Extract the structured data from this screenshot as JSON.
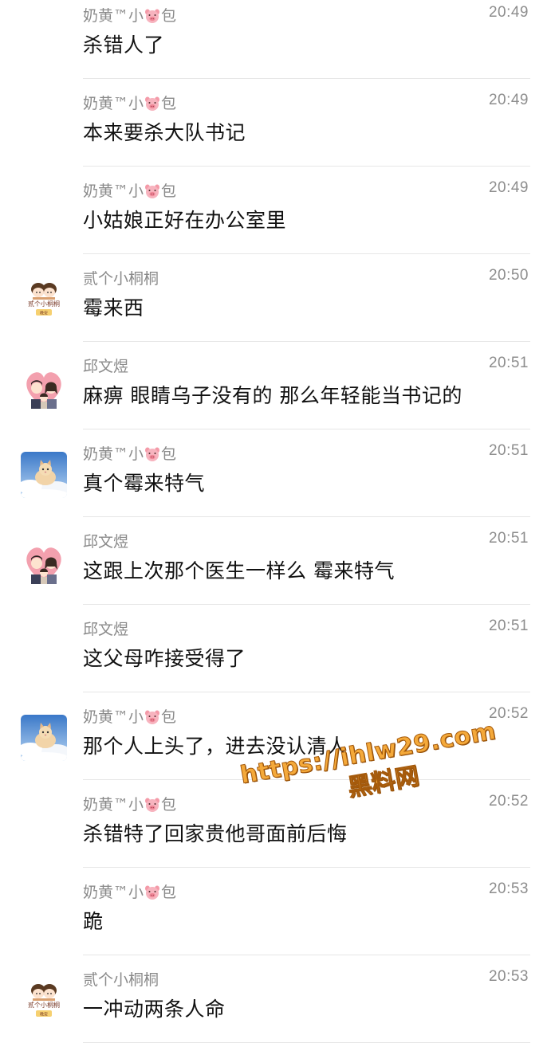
{
  "messages": [
    {
      "sender_pre": "奶黄™小",
      "sender_post": "包",
      "pig": true,
      "time": "20:49",
      "text": "杀错人了",
      "avatar": "none"
    },
    {
      "sender_pre": "奶黄™小",
      "sender_post": "包",
      "pig": true,
      "time": "20:49",
      "text": "本来要杀大队书记",
      "avatar": "none"
    },
    {
      "sender_pre": "奶黄™小",
      "sender_post": "包",
      "pig": true,
      "time": "20:49",
      "text": "小姑娘正好在办公室里",
      "avatar": "none"
    },
    {
      "sender_pre": "贰个小桐桐",
      "sender_post": "",
      "pig": false,
      "time": "20:50",
      "text": "霉来西",
      "avatar": "tongtong",
      "avatar_line1": "贰个小桐桐",
      "avatar_line2": "晚安"
    },
    {
      "sender_pre": "邱文煜",
      "sender_post": "",
      "pig": false,
      "time": "20:51",
      "text": "麻痹 眼睛乌子没有的 那么年轻能当书记的",
      "avatar": "family"
    },
    {
      "sender_pre": "奶黄™小",
      "sender_post": "包",
      "pig": true,
      "time": "20:51",
      "text": "真个霉来特气",
      "avatar": "cat"
    },
    {
      "sender_pre": "邱文煜",
      "sender_post": "",
      "pig": false,
      "time": "20:51",
      "text": "这跟上次那个医生一样么 霉来特气",
      "avatar": "family"
    },
    {
      "sender_pre": "邱文煜",
      "sender_post": "",
      "pig": false,
      "time": "20:51",
      "text": "这父母咋接受得了",
      "avatar": "none"
    },
    {
      "sender_pre": "奶黄™小",
      "sender_post": "包",
      "pig": true,
      "time": "20:52",
      "text": "那个人上头了，进去没认清人",
      "avatar": "cat"
    },
    {
      "sender_pre": "奶黄™小",
      "sender_post": "包",
      "pig": true,
      "time": "20:52",
      "text": "杀错特了回家贵他哥面前后悔",
      "avatar": "none"
    },
    {
      "sender_pre": "奶黄™小",
      "sender_post": "包",
      "pig": true,
      "time": "20:53",
      "text": "跪",
      "avatar": "none"
    },
    {
      "sender_pre": "贰个小桐桐",
      "sender_post": "",
      "pig": false,
      "time": "20:53",
      "text": "一冲动两条人命",
      "avatar": "tongtong",
      "avatar_line1": "贰个小桐桐",
      "avatar_line2": "晚安"
    }
  ],
  "watermark": {
    "line1": "https://ihlw29.com",
    "line2": "黑料网"
  },
  "colors": {
    "sender": "#8a8a8a",
    "time": "#8d8d8d",
    "text": "#111111",
    "divider": "#e6e6e6",
    "watermark": "#f4a93a"
  }
}
